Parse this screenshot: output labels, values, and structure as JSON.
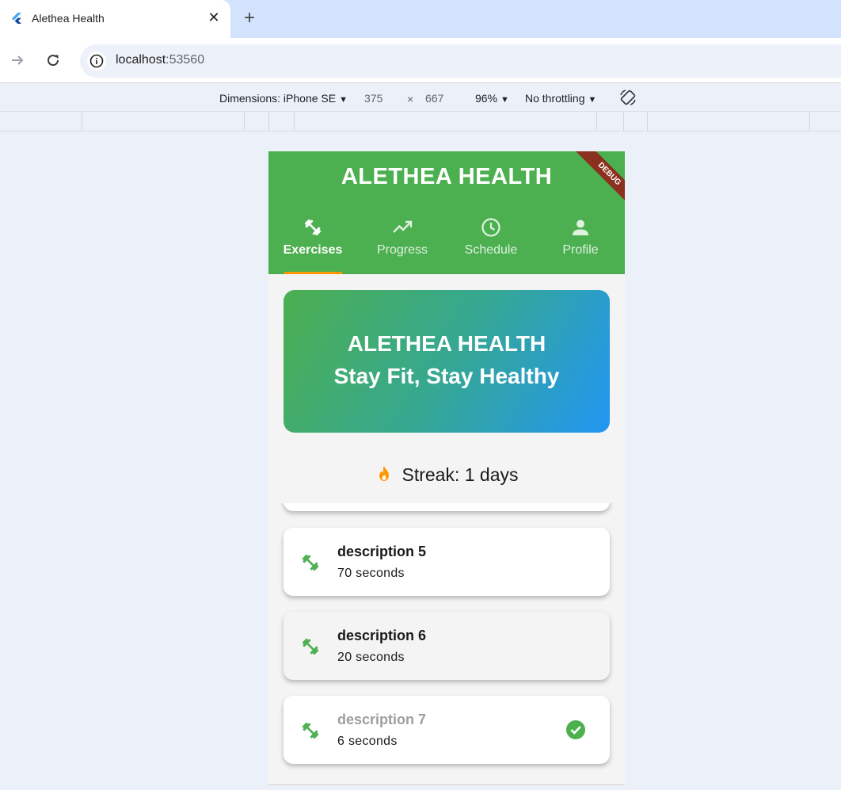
{
  "browser": {
    "tab_title": "Alethea Health",
    "tab_close": "✕",
    "new_tab": "+",
    "url_host": "localhost",
    "url_port": ":53560"
  },
  "devtools": {
    "dimensions_label": "Dimensions: iPhone SE",
    "width": "375",
    "times": "×",
    "height": "667",
    "zoom": "96%",
    "throttling": "No throttling"
  },
  "app": {
    "title": "ALETHEA HEALTH",
    "debug_label": "DEBUG",
    "tabs": [
      {
        "label": "Exercises",
        "icon": "dumbbell-icon",
        "active": true
      },
      {
        "label": "Progress",
        "icon": "trending-up-icon",
        "active": false
      },
      {
        "label": "Schedule",
        "icon": "clock-icon",
        "active": false
      },
      {
        "label": "Profile",
        "icon": "person-icon",
        "active": false
      }
    ],
    "hero": {
      "line1": "ALETHEA HEALTH",
      "line2": "Stay Fit, Stay Healthy"
    },
    "streak": {
      "text": "Streak: 1 days",
      "icon": "flame-icon"
    },
    "exercises": [
      {
        "title": "description 5",
        "duration": "70 seconds",
        "completed": false
      },
      {
        "title": "description 6",
        "duration": "20 seconds",
        "completed": false
      },
      {
        "title": "description 7",
        "duration": "6 seconds",
        "completed": true
      }
    ]
  },
  "colors": {
    "primary": "#4caf50",
    "accent": "#ff9800",
    "gradient_end": "#2196f3",
    "debug_banner": "#8b2f1e"
  }
}
